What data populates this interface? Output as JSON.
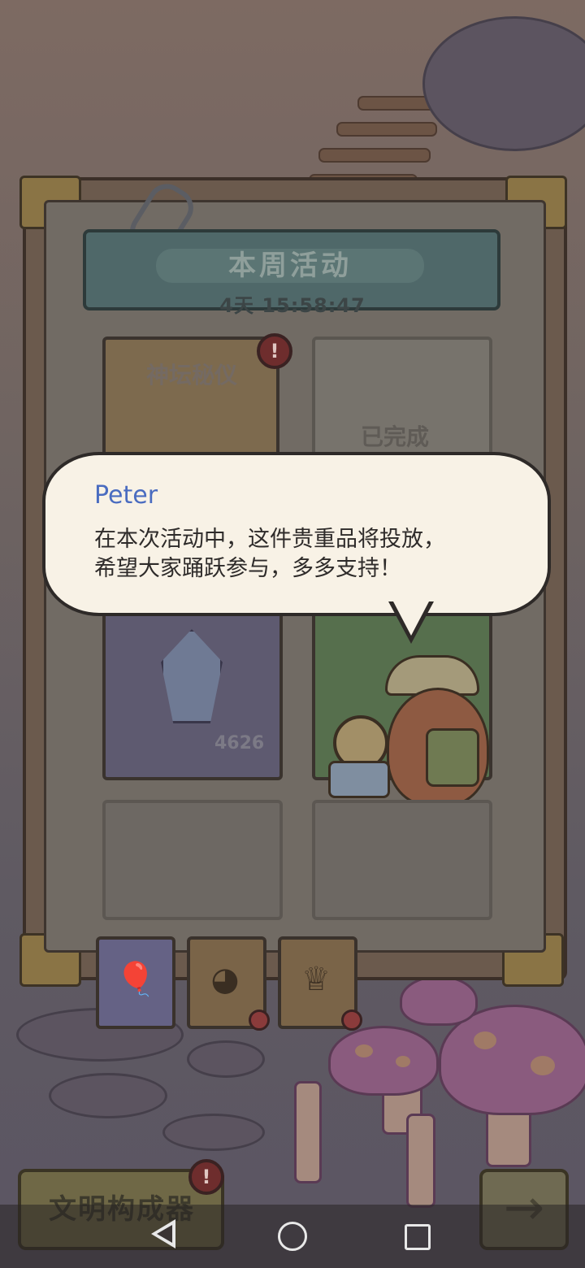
{
  "panel": {
    "title": "本周活动",
    "timer": "4天 15:58:47"
  },
  "cards": [
    {
      "label": "神坛秘仪",
      "alert": "!"
    },
    {
      "label": "已完成"
    },
    {
      "count": "4626"
    }
  ],
  "dialog": {
    "speaker": "Peter",
    "line1": "在本次活动中，这件贵重品将投放，",
    "line2": "希望大家踊跃参与，多多支持！"
  },
  "tabs": [
    {
      "icon": "balloon-icon"
    },
    {
      "icon": "bowl-icon"
    },
    {
      "icon": "crown-icon"
    }
  ],
  "bottom": {
    "left_button": "文明构成器",
    "alert": "!",
    "arrow": "→"
  }
}
